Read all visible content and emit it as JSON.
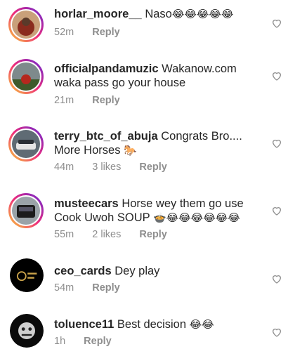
{
  "comments": [
    {
      "username": "horlar_moore__",
      "text": "Naso",
      "emoji": "😂😂😂😂😂",
      "time": "52m",
      "likes": "",
      "reply": "Reply"
    },
    {
      "username": "officialpandamuzic",
      "text": "Wakanow.com waka pass go your house",
      "emoji": "",
      "time": "21m",
      "likes": "",
      "reply": "Reply"
    },
    {
      "username": "terry_btc_of_abuja",
      "text": "Congrats Bro.... More Horses",
      "emoji": "🐎",
      "time": "44m",
      "likes": "3 likes",
      "reply": "Reply"
    },
    {
      "username": "musteecars",
      "text": "Horse wey them go use Cook Uwoh SOUP",
      "emoji": "🍲😂😂😂😂😂😂",
      "time": "55m",
      "likes": "2 likes",
      "reply": "Reply"
    },
    {
      "username": "ceo_cards",
      "text": "Dey play",
      "emoji": "",
      "time": "54m",
      "likes": "",
      "reply": "Reply"
    },
    {
      "username": "toluence11",
      "text": "Best decision",
      "emoji": "😂😂",
      "time": "1h",
      "likes": "",
      "reply": "Reply"
    }
  ],
  "icons": {
    "like": "heart-outline-icon"
  }
}
